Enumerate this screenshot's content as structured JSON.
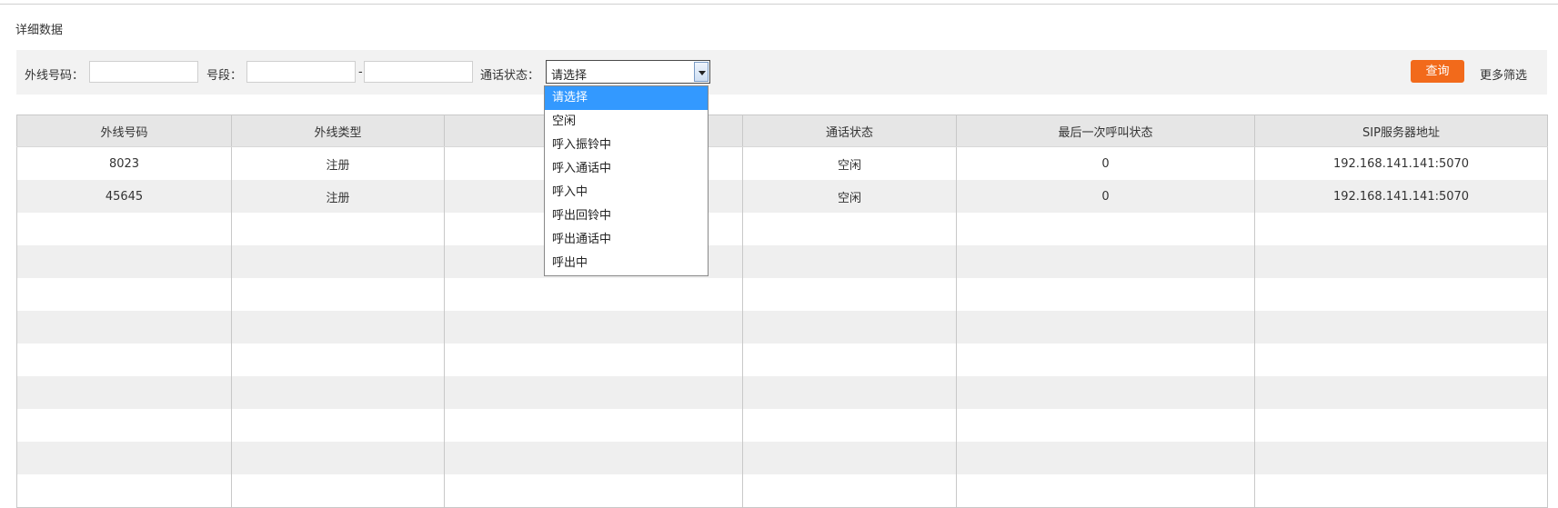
{
  "page": {
    "title": "详细数据"
  },
  "filters": {
    "outline_label": "外线号码：",
    "outline_value": "",
    "segment_label": "号段：",
    "segment_from": "",
    "segment_sep": "-",
    "segment_to": "",
    "status_label": "通话状态：",
    "status_selected": "请选择",
    "query_label": "查询",
    "more_label": "更多筛选"
  },
  "dropdown": {
    "options": [
      "请选择",
      "空闲",
      "呼入振铃中",
      "呼入通话中",
      "呼入中",
      "呼出回铃中",
      "呼出通话中",
      "呼出中"
    ],
    "highlighted_index": 0
  },
  "table": {
    "headers": [
      "外线号码",
      "外线类型",
      "",
      "通话状态",
      "最后一次呼叫状态",
      "SIP服务器地址"
    ],
    "rows": [
      [
        "8023",
        "注册",
        "",
        "空闲",
        "0",
        "192.168.141.141:5070"
      ],
      [
        "45645",
        "注册",
        "",
        "空闲",
        "0",
        "192.168.141.141:5070"
      ],
      [
        "",
        "",
        "",
        "",
        "",
        ""
      ],
      [
        "",
        "",
        "",
        "",
        "",
        ""
      ],
      [
        "",
        "",
        "",
        "",
        "",
        ""
      ],
      [
        "",
        "",
        "",
        "",
        "",
        ""
      ],
      [
        "",
        "",
        "",
        "",
        "",
        ""
      ],
      [
        "",
        "",
        "",
        "",
        "",
        ""
      ],
      [
        "",
        "",
        "",
        "",
        "",
        ""
      ],
      [
        "",
        "",
        "",
        "",
        "",
        ""
      ],
      [
        "",
        "",
        "",
        "",
        "",
        ""
      ]
    ]
  },
  "colors": {
    "accent": "#f26a1b",
    "highlight": "#3399ff",
    "header_bg": "#e6e6e6",
    "stripe": "#efefef"
  }
}
